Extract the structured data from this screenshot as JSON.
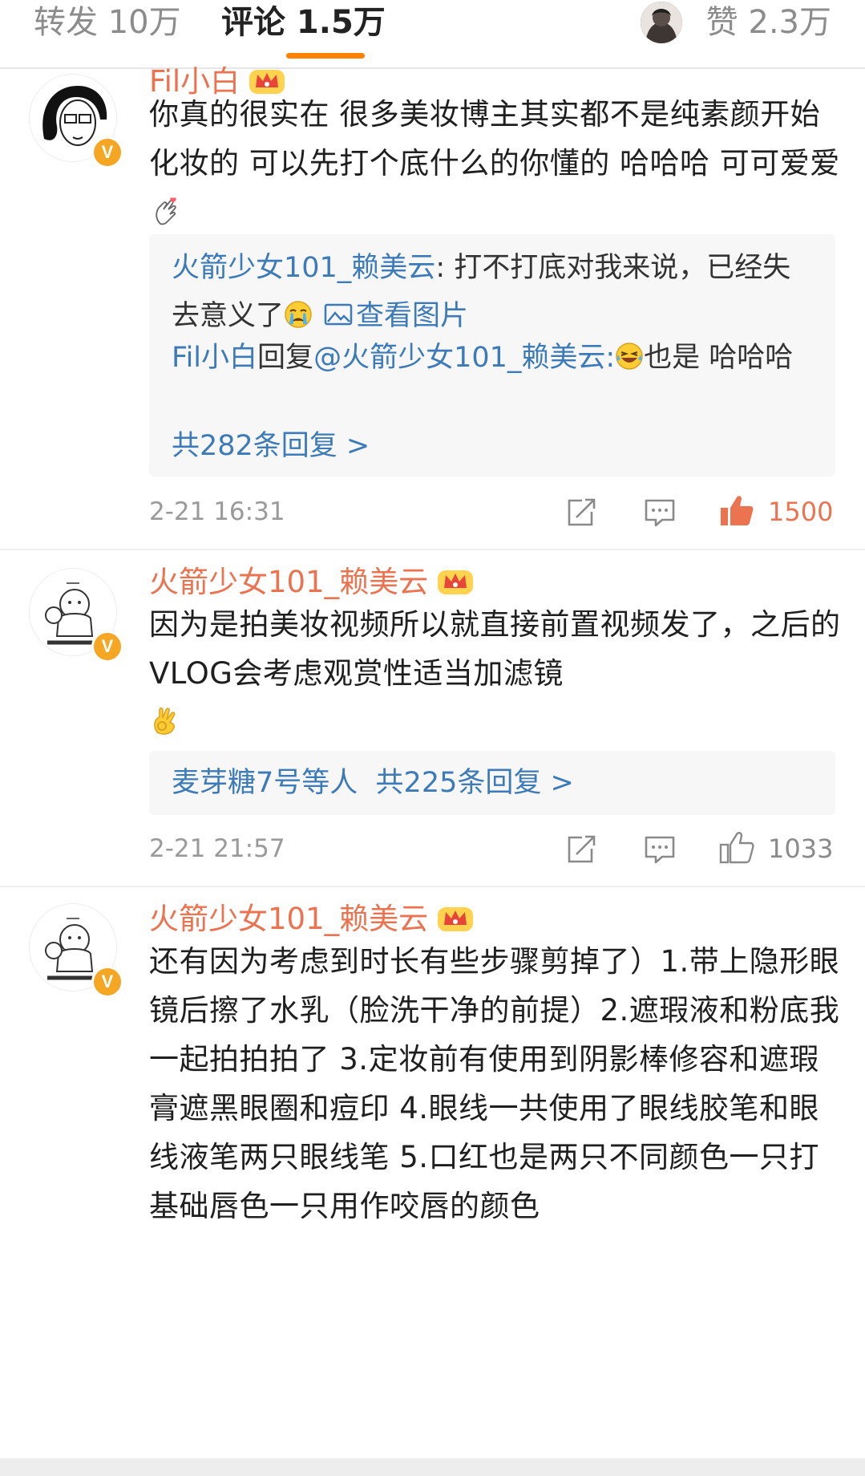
{
  "tabs": {
    "forward": "转发 10万",
    "comment": "评论 1.5万",
    "like": "赞 2.3万"
  },
  "colors": {
    "accent": "#ff8200",
    "username": "#eb7350",
    "link": "#3c7bb8",
    "liked": "#eb7350",
    "muted": "#9a9a9a"
  },
  "comments": [
    {
      "username": "Fil小白",
      "badge_icon": "crown-icon",
      "verified": "V",
      "text": "你真的很实在 很多美妆博主其实都不是纯素颜开始化妆的 可以先打个底什么的你懂的 哈哈哈 可可爱爱",
      "text_emoji": "finger-heart-emoji",
      "replies": [
        {
          "name": "火箭少女101_赖美云",
          "text": ": 打不打底对我来说，已经失去意义了",
          "emoji": "crying-emoji",
          "link": "查看图片"
        },
        {
          "name": "Fil小白",
          "text_pre": "回复",
          "mention": "@火箭少女101_赖美云",
          "text_mid": ":",
          "emoji": "laughing-emoji",
          "text": "也是 哈哈哈"
        }
      ],
      "more": "共282条回复 >",
      "time": "2-21 16:31",
      "likes": "1500",
      "liked": true
    },
    {
      "username": "火箭少女101_赖美云",
      "badge_icon": "crown-icon",
      "verified": "V",
      "text": "因为是拍美妆视频所以就直接前置视频发了，之后的VLOG会考虑观赏性适当加滤镜",
      "text_emoji": "ok-hand-emoji",
      "reply_summary_name": "麦芽糖7号等人",
      "reply_summary_count": "共225条回复 >",
      "time": "2-21 21:57",
      "likes": "1033",
      "liked": false
    },
    {
      "username": "火箭少女101_赖美云",
      "badge_icon": "crown-icon",
      "verified": "V",
      "text": "还有因为考虑到时长有些步骤剪掉了）1.带上隐形眼镜后擦了水乳（脸洗干净的前提）2.遮瑕液和粉底我一起拍拍拍了 3.定妆前有使用到阴影棒修容和遮瑕膏遮黑眼圈和痘印 4.眼线一共使用了眼线胶笔和眼线液笔两只眼线笔 5.口红也是两只不同颜色一只打基础唇色一只用作咬唇的颜色"
    }
  ]
}
